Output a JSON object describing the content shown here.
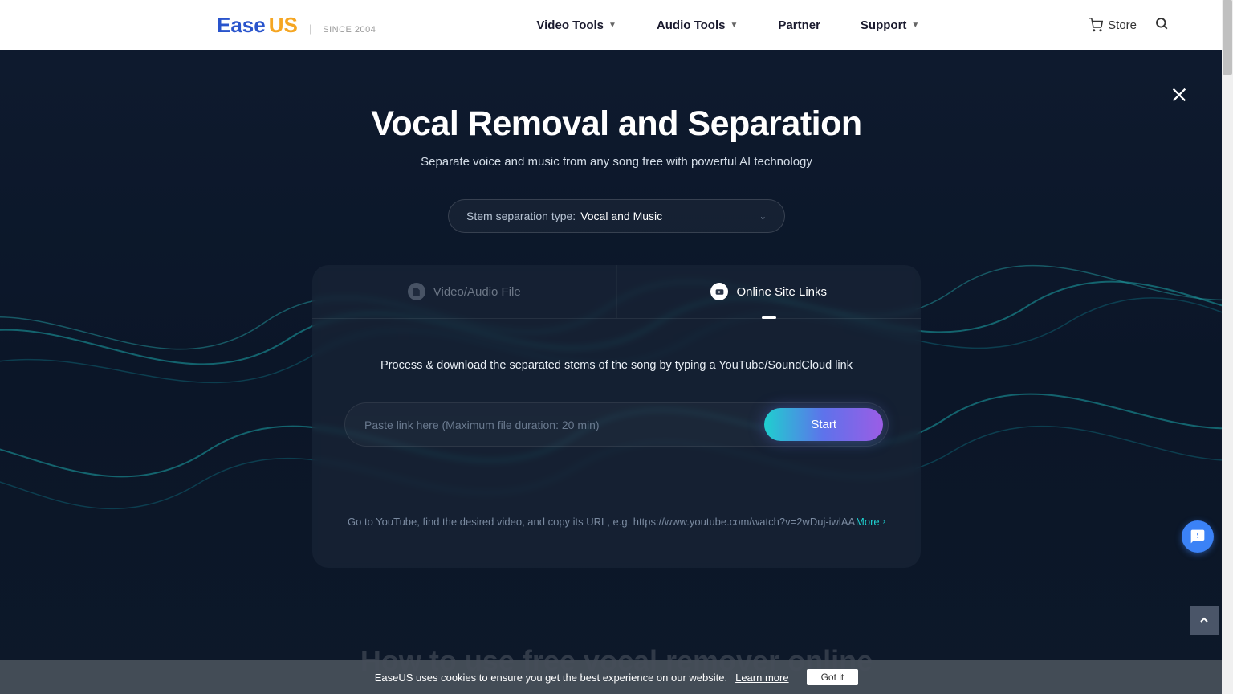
{
  "header": {
    "logo": {
      "ease": "Ease",
      "us": "US",
      "since": "SINCE 2004"
    },
    "nav": [
      {
        "label": "Video Tools",
        "hasDropdown": true
      },
      {
        "label": "Audio Tools",
        "hasDropdown": true
      },
      {
        "label": "Partner",
        "hasDropdown": false
      },
      {
        "label": "Support",
        "hasDropdown": true
      }
    ],
    "store": "Store"
  },
  "hero": {
    "title": "Vocal Removal and Separation",
    "subtitle": "Separate voice and music from any song free with powerful AI technology",
    "dropdown": {
      "label": "Stem separation type:",
      "value": "Vocal and Music"
    },
    "tabs": [
      {
        "label": "Video/Audio File",
        "active": false
      },
      {
        "label": "Online Site Links",
        "active": true
      }
    ],
    "instruction": "Process & download the separated stems of the song by typing a YouTube/SoundCloud link",
    "placeholder": "Paste link here (Maximum file duration: 20 min)",
    "startLabel": "Start",
    "hint": "Go to YouTube, find the desired video, and copy its URL, e.g. https://www.youtube.com/watch?v=2wDuj-iwlAA",
    "more": "More"
  },
  "below": "How to use free vocal remover online",
  "cookie": {
    "text": "EaseUS uses cookies to ensure you get the best experience on our website.",
    "learn": "Learn more",
    "button": "Got it"
  }
}
